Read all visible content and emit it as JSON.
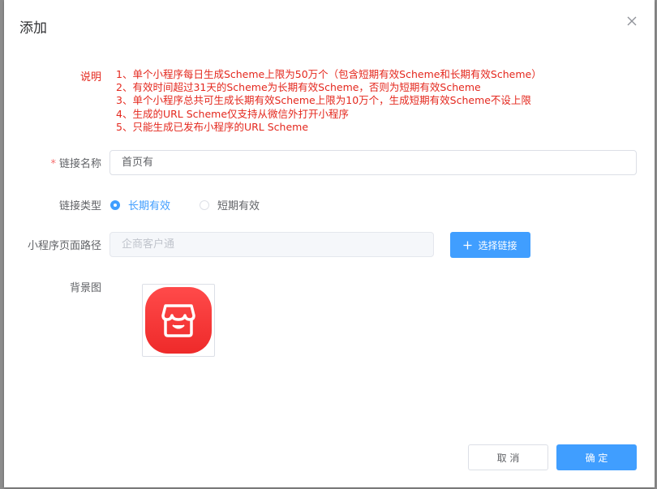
{
  "dialog": {
    "title": "添加",
    "close_icon": "close-icon"
  },
  "notes": {
    "label": "说明",
    "lines": [
      "1、单个小程序每日生成Scheme上限为50万个（包含短期有效Scheme和长期有效Scheme）",
      "2、有效时间超过31天的Scheme为长期有效Scheme，否则为短期有效Scheme",
      "3、单个小程序总共可生成长期有效Scheme上限为10万个，生成短期有效Scheme不设上限",
      "4、生成的URL Scheme仅支持从微信外打开小程序",
      "5、只能生成已发布小程序的URL Scheme"
    ],
    "color": "#e4281e"
  },
  "form": {
    "link_name": {
      "required_mark": "*",
      "label": "链接名称",
      "value": "首页有"
    },
    "link_type": {
      "label": "链接类型",
      "options": [
        "长期有效",
        "短期有效"
      ],
      "selected": "长期有效"
    },
    "page_path": {
      "label": "小程序页面路径",
      "placeholder": "企商客户通",
      "button_label": "选择链接",
      "button_icon": "plus-icon"
    },
    "background": {
      "label": "背景图",
      "image_icon": "store-icon"
    }
  },
  "footer": {
    "cancel_label": "取 消",
    "confirm_label": "确 定"
  },
  "colors": {
    "primary": "#409eff",
    "danger": "#f56c6c",
    "image_red": "#f23a3a"
  }
}
